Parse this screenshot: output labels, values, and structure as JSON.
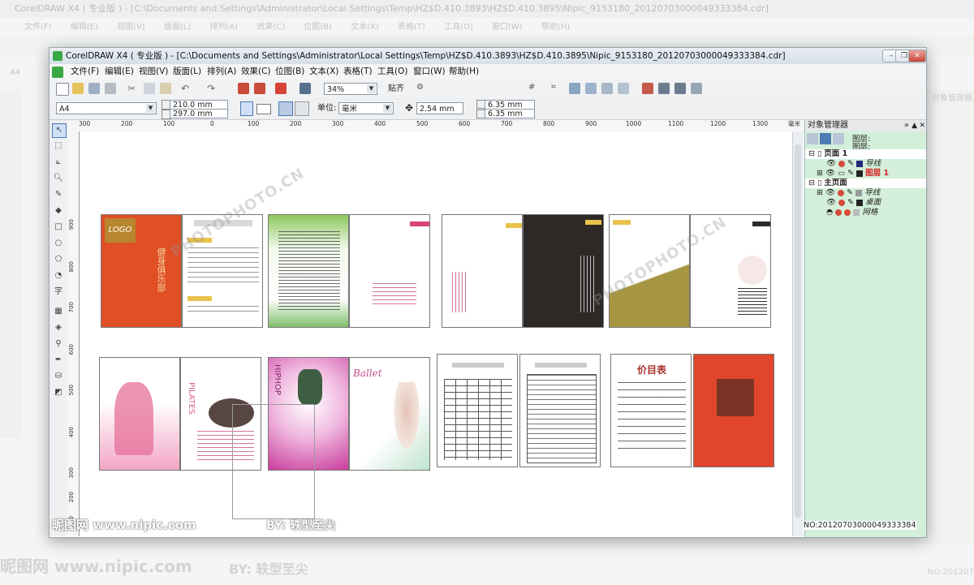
{
  "background_app": {
    "title": "CorelDRAW X4 ( 专业版 ) - [C:\\Documents and Settings\\Administrator\\Local Settings\\Temp\\HZ$D.410.3893\\HZ$D.410.3895\\Nipic_9153180_20120703000049333384.cdr]",
    "menu": [
      "文件(F)",
      "编辑(E)",
      "视图(V)",
      "版面(L)",
      "排列(A)",
      "效果(C)",
      "位图(B)",
      "文本(X)",
      "表格(T)",
      "工具(O)",
      "窗口(W)",
      "帮助(H)"
    ],
    "page_label": "A4",
    "panel_title": "对象管理器",
    "code_fragment": "NO:20120703"
  },
  "window": {
    "title": "CorelDRAW X4 ( 专业版 ) - [C:\\Documents and Settings\\Administrator\\Local Settings\\Temp\\HZ$D.410.3893\\HZ$D.410.3895\\Nipic_9153180_20120703000049333384.cdr]",
    "minimize_icon": "minimize-icon",
    "maximize_icon": "restore-icon",
    "close_icon": "close-icon"
  },
  "menu": [
    {
      "label": "文件(F)"
    },
    {
      "label": "编辑(E)"
    },
    {
      "label": "视图(V)"
    },
    {
      "label": "版面(L)"
    },
    {
      "label": "排列(A)"
    },
    {
      "label": "效果(C)"
    },
    {
      "label": "位图(B)"
    },
    {
      "label": "文本(X)"
    },
    {
      "label": "表格(T)"
    },
    {
      "label": "工具(O)"
    },
    {
      "label": "窗口(W)"
    },
    {
      "label": "帮助(H)"
    }
  ],
  "toolbar": {
    "zoom": "34%",
    "snap_label": "贴齐"
  },
  "property_bar": {
    "paper": "A4",
    "width": "210.0 mm",
    "height": "297.0 mm",
    "units_label": "单位:",
    "units": "毫米",
    "nudge": "2.54 mm",
    "dup_x": "6.35 mm",
    "dup_y": "6.35 mm"
  },
  "ruler": {
    "h_ticks": [
      "300",
      "200",
      "100",
      "0",
      "100",
      "200",
      "300",
      "400",
      "500",
      "600",
      "700",
      "800",
      "900",
      "1000",
      "1100",
      "1200",
      "1300"
    ],
    "h_unit": "毫米",
    "v_ticks": [
      "900",
      "800",
      "700",
      "600",
      "500",
      "400",
      "300",
      "200",
      "100"
    ]
  },
  "object_manager": {
    "title": "对象管理器",
    "page_label": "图层:",
    "page_value": "图层 1",
    "tree": [
      {
        "label": "页面 1",
        "type": "page"
      },
      {
        "label": "导线",
        "type": "layer"
      },
      {
        "label": "图层 1",
        "type": "layer-active"
      },
      {
        "label": "主页面",
        "type": "page"
      },
      {
        "label": "导线",
        "type": "layer"
      },
      {
        "label": "桌面",
        "type": "layer"
      },
      {
        "label": "网格",
        "type": "layer"
      }
    ],
    "footer_code": "NO:20120703000049333384"
  },
  "canvas_text": {
    "logo": "LOGO",
    "menu_title": "价目表",
    "ballet": "Ballet",
    "pilates": "PILATES",
    "vertical_title": "健身俱乐部",
    "hiphop": "HIPHOP"
  },
  "watermarks": {
    "nipic": "昵图网 www.nipic.com",
    "user": "BY: 轶型至尖",
    "photo_cn": "PHOTOPHOTO.CN"
  }
}
